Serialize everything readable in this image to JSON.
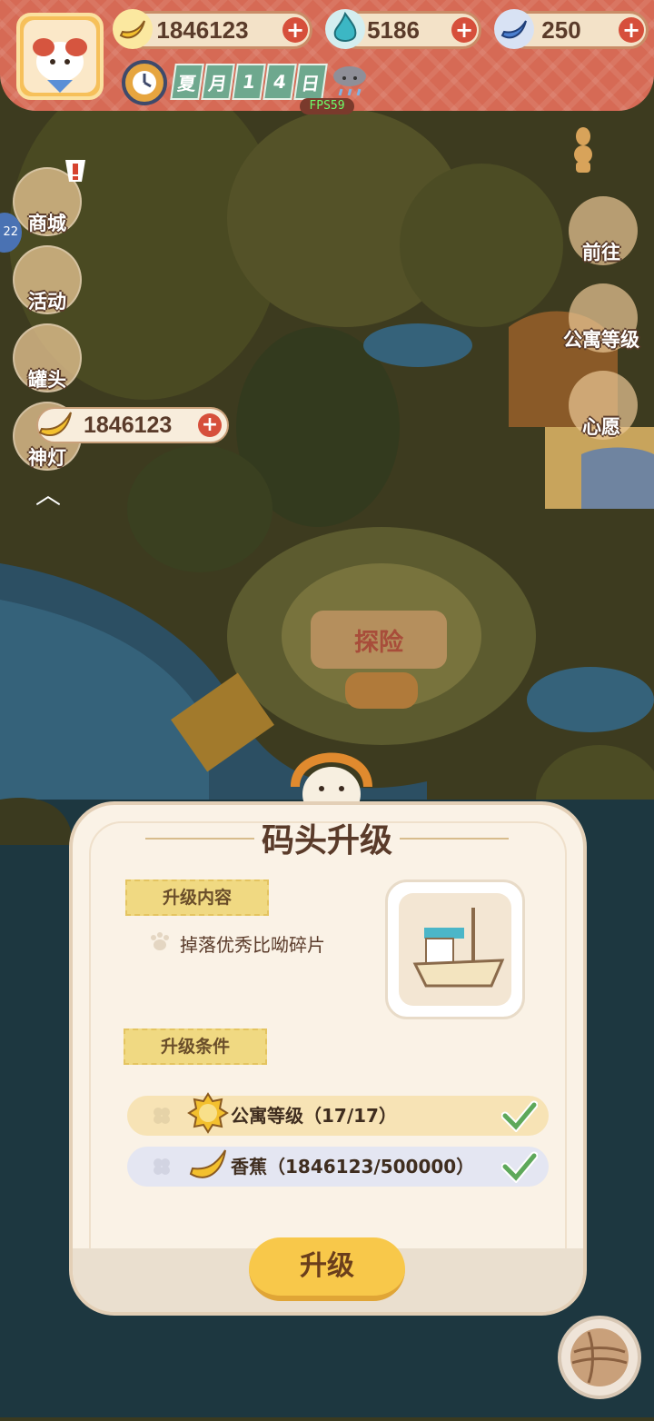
{
  "resources": {
    "banana": "1846123",
    "blue_flame": "5186",
    "blue_banana": "250",
    "plus": "+"
  },
  "calendar": {
    "chars": [
      "夏",
      "月",
      "1",
      "4",
      "日"
    ]
  },
  "fps": "FPS59",
  "left_menu": {
    "badge": "22",
    "items": [
      {
        "label": "商城"
      },
      {
        "label": "活动"
      },
      {
        "label": "罐头"
      },
      {
        "label": "神灯"
      }
    ],
    "collapse": "︿"
  },
  "right_menu": {
    "items": [
      {
        "label": "前往"
      },
      {
        "label": "公寓等级"
      },
      {
        "label": "心愿"
      }
    ]
  },
  "floating_banana": "1846123",
  "explore_label": "探险",
  "panel": {
    "title": "码头升级",
    "content_tag": "升级内容",
    "content_text": "掉落优秀比呦碎片",
    "condition_tag": "升级条件",
    "conditions": [
      {
        "text": "公寓等级（17/17）",
        "met": true
      },
      {
        "text": "香蕉（1846123/500000）",
        "met": true
      }
    ],
    "button": "升级"
  },
  "colors": {
    "topbar": "#d66a55",
    "panel": "#faf2e6",
    "button": "#f8c84a",
    "cond1": "#f7e3b5",
    "cond2": "#e4e6f2",
    "check": "#5ea85a"
  },
  "icons": [
    "banana-icon",
    "blue-flame-icon",
    "blue-banana-icon",
    "clock-icon",
    "rain-cloud-icon",
    "paw-icon",
    "ship-icon",
    "clover-icon",
    "check-icon",
    "yarn-ball-icon"
  ]
}
